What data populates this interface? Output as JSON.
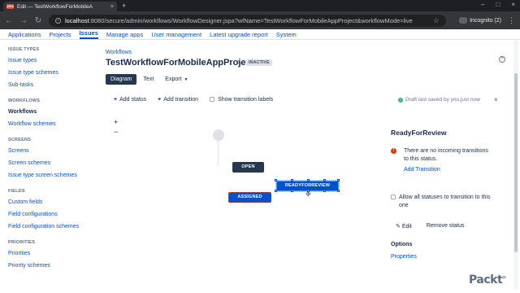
{
  "browser": {
    "tab_title": "Edit — TestWorkflowForMobileA",
    "tab_favicon_text": "JIRA",
    "url_host": "localhost",
    "url_rest": ":8080/secure/admin/workflows/WorkflowDesigner.jspa?wfName=TestWorkflowForMobileAppProject&workflowMode=live",
    "incognito_label": "Incognito (2)"
  },
  "app_nav": [
    "Applications",
    "Projects",
    "Issues",
    "Manage apps",
    "User management",
    "Latest upgrade report",
    "System"
  ],
  "sidebar": {
    "sections": [
      {
        "heading": "ISSUE TYPES",
        "items": [
          "Issue types",
          "Issue type schemes",
          "Sub-tasks"
        ]
      },
      {
        "heading": "WORKFLOWS",
        "items": [
          "Workflows",
          "Workflow schemes"
        ]
      },
      {
        "heading": "SCREENS",
        "items": [
          "Screens",
          "Screen schemes",
          "Issue type screen schemes"
        ]
      },
      {
        "heading": "FIELDS",
        "items": [
          "Custom fields",
          "Field configurations",
          "Field configuration schemes"
        ]
      },
      {
        "heading": "PRIORITIES",
        "items": [
          "Priorities",
          "Priority schemes"
        ]
      }
    ]
  },
  "main": {
    "breadcrumb": "Workflows",
    "title": "TestWorkflowForMobileAppProject",
    "badge": "INACTIVE",
    "tabs": {
      "diagram": "Diagram",
      "text": "Text",
      "export": "Export"
    },
    "toolbar": {
      "add_status": "Add status",
      "add_transition": "Add transition",
      "show_labels": "Show transition labels",
      "draft_note": "Draft last saved by you,just now"
    },
    "zoom": {
      "plus": "+",
      "minus": "−"
    },
    "diagram": {
      "open": "OPEN",
      "assigned": "ASSIGNED",
      "ready": "READYFORREVIEW"
    }
  },
  "panel": {
    "title": "ReadyForReview",
    "warning": "There are no incoming transitions to this status.",
    "add_transition": "Add Transition",
    "allow_all": "Allow all statuses to transition to this one",
    "edit": "Edit",
    "remove": "Remove status",
    "options_heading": "Options",
    "properties": "Properties"
  },
  "watermark": {
    "text": "Packt",
    "suffix": ">"
  }
}
